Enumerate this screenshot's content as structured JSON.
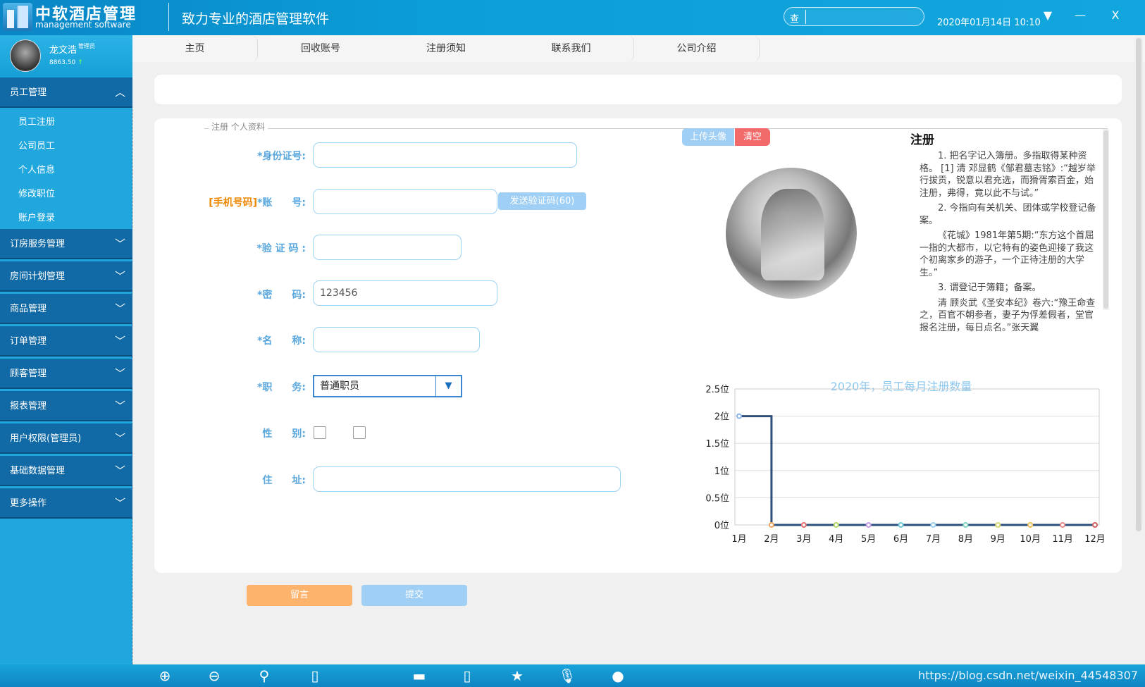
{
  "app": {
    "title": "中软酒店管理",
    "subtitle": "management software",
    "slogan": "致力专业的酒店管理软件"
  },
  "search": {
    "icon_label": "查",
    "value": ""
  },
  "datetime": "2020年01月14日 10:10",
  "window_controls": {
    "dropdown": "▼",
    "minimize": "—",
    "close": "X"
  },
  "user": {
    "name": "龙文浩",
    "role": "管理员",
    "balance": "8863.50",
    "trend": "↑"
  },
  "sidebar": {
    "active_group": "员工管理",
    "active_items": [
      "员工注册",
      "公司员工",
      "个人信息",
      "修改职位",
      "账户登录"
    ],
    "groups": [
      "订房服务管理",
      "房间计划管理",
      "商品管理",
      "订单管理",
      "顾客管理",
      "报表管理",
      "用户权限(管理员)",
      "基础数据管理",
      "更多操作"
    ]
  },
  "nav": {
    "tabs": [
      "主页",
      "回收账号",
      "注册须知",
      "联系我们",
      "公司介绍"
    ]
  },
  "form": {
    "legend": "注册 个人资料",
    "id_label": "*身份证号:",
    "id_value": "",
    "account_prefix": "[手机号码]",
    "account_label": "*账　　号:",
    "account_value": "",
    "send_code": "发送验证码(60)",
    "code_label": "*验 证 码 :",
    "code_value": "",
    "password_label": "*密　　码:",
    "password_value": "123456",
    "name_label": "*名　　称:",
    "name_value": "",
    "job_label": "*职　　务:",
    "job_value": "普通职员",
    "gender_label": "性　　别:",
    "address_label": "住　　址:",
    "address_value": ""
  },
  "photo": {
    "upload": "上传头像",
    "clear": "清空"
  },
  "notice": {
    "title": "注册",
    "paragraphs": [
      "1. 把名字记入簿册。多指取得某种资格。 [1] 清 邓显鹤《邹君墓志铭》:“越岁举行拔贡，锐意以君充选，而猾胥索百金，始注册，弗得，竟以此不与试。”",
      "2. 今指向有关机关、团体或学校登记备案。",
      "《花城》1981年第5期:“东方这个首屈一指的大都市，以它特有的姿色迎接了我这个初离家乡的游子，一个正待注册的大学生。”",
      "3. 谓登记于簿籍；备案。",
      "清 顾炎武《圣安本纪》卷六:“豫王命查之，百官不朝参者，妻子为俘差假者，堂官报名注册，每日点名。”张天翼"
    ]
  },
  "buttons": {
    "message": "留言",
    "submit": "提交"
  },
  "bottom": {
    "url": "https://blog.csdn.net/weixin_44548307"
  },
  "chart_data": {
    "type": "line",
    "title": "2020年，员工每月注册数量",
    "x": [
      "1月",
      "2月",
      "3月",
      "4月",
      "5月",
      "6月",
      "7月",
      "8月",
      "9月",
      "10月",
      "11月",
      "12月"
    ],
    "values": [
      2,
      0,
      0,
      0,
      0,
      0,
      0,
      0,
      0,
      0,
      0,
      0
    ],
    "y_ticks": [
      "0位",
      "0.5位",
      "1位",
      "1.5位",
      "2位",
      "2.5位"
    ],
    "ylim": [
      0,
      2.5
    ],
    "step": true,
    "grid": true,
    "line_color": "#2c4f7c",
    "title_color": "#8cc7ee"
  }
}
